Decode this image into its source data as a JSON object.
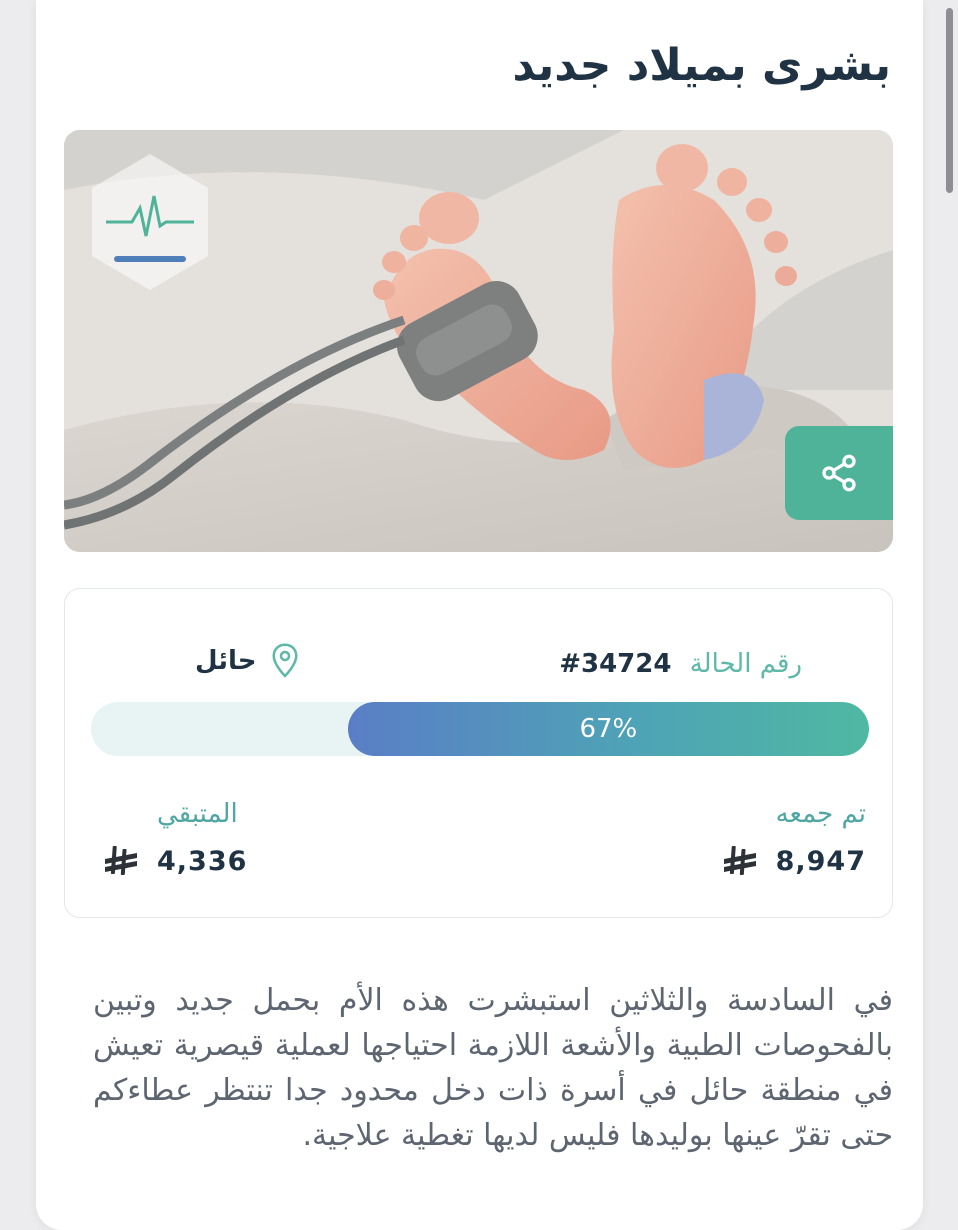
{
  "card": {
    "title": "بشرى بميلاد جديد"
  },
  "hero": {
    "image_subject": "newborn baby feet with pulse oximeter sensor held in an adult hand",
    "logo_icon": "charity-heartbeat-logo",
    "share_icon": "share-icon"
  },
  "case": {
    "label": "رقم الحالة",
    "number": "34724#"
  },
  "location": {
    "icon": "location-pin-icon",
    "text": "حائل"
  },
  "progress": {
    "percent": 67,
    "label": "67%"
  },
  "raised": {
    "label": "تم جمعه",
    "value": "8,947",
    "currency_icon": "saudi-riyal-icon"
  },
  "remaining": {
    "label": "المتبقي",
    "value": "4,336",
    "currency_icon": "saudi-riyal-icon"
  },
  "description": "في السادسة والثلاثين استبشرت هذه الأم بحمل جديد وتبين بالفحوصات الطبية والأشعة اللازمة احتياجها لعملية قيصرية تعيش في منطقة حائل في أسرة ذات دخل محدود جدا تنتظر عطاءكم حتى تقرّ عينها بوليدها فليس لديها تغطية علاجية.",
  "colors": {
    "accent": "#4fb39a",
    "title": "#1f3344",
    "label_teal": "#5eb8a8",
    "progress_start": "#5a7ec6",
    "progress_end": "#4fb8a2"
  }
}
